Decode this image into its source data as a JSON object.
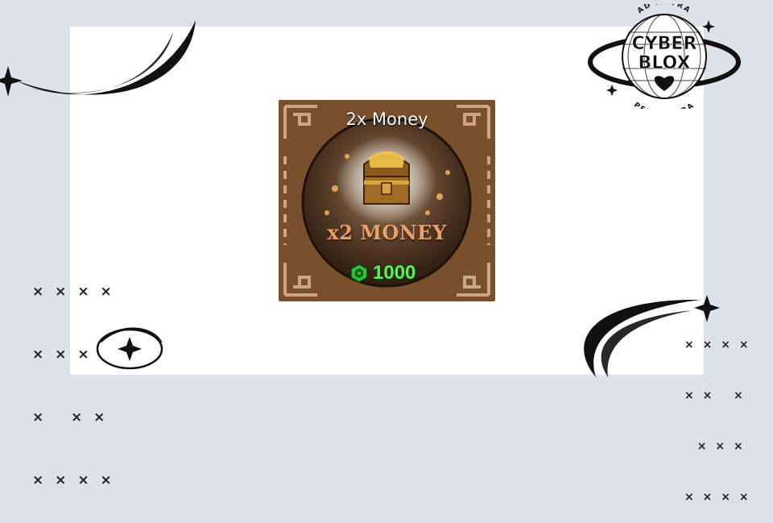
{
  "item": {
    "title": "2x Money",
    "gain_label": "x2 MONEY",
    "price": "1000",
    "currency_icon": "robux-icon",
    "colors": {
      "frame": "#7a4f2c",
      "price": "#5cf05a",
      "gain": "#e8a06a"
    }
  },
  "logo": {
    "top_text": "AD ASTRA",
    "line1": "CYBER",
    "line2": "BLOX",
    "bottom_text": "PER ASPERA"
  },
  "decor": {
    "left_x_rows": [
      "× × × ×",
      "× × ×",
      "×   × ×",
      "× × × ×"
    ],
    "right_x_rows": [
      "× × × ×",
      "× ×   ×",
      "  × × ×",
      "× × × ×"
    ]
  }
}
